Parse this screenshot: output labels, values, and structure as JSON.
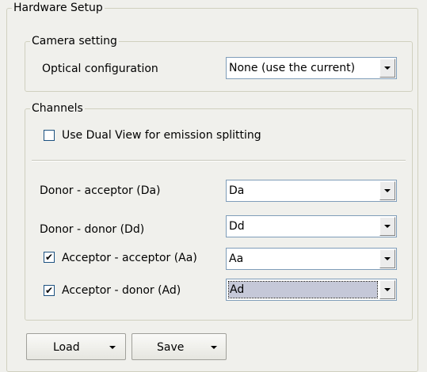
{
  "hardware_setup": {
    "title": "Hardware Setup",
    "camera_setting": {
      "title": "Camera setting",
      "optical_label": "Optical configuration",
      "optical_value": "None (use the current)"
    },
    "channels": {
      "title": "Channels",
      "dual_view_label": "Use Dual View for emission splitting",
      "dual_view_checked": false,
      "rows": [
        {
          "label": "Donor - acceptor (Da)",
          "value": "Da"
        },
        {
          "label": "Donor - donor (Dd)",
          "value": "Dd"
        },
        {
          "label": "Acceptor - acceptor (Aa)",
          "value": "Aa",
          "checked": true
        },
        {
          "label": "Acceptor - donor (Ad)",
          "value": "Ad",
          "checked": true
        }
      ]
    },
    "buttons": {
      "load": "Load",
      "save": "Save"
    }
  },
  "icons": {
    "checkmark": "✔",
    "dropdown": "triangle-down"
  }
}
